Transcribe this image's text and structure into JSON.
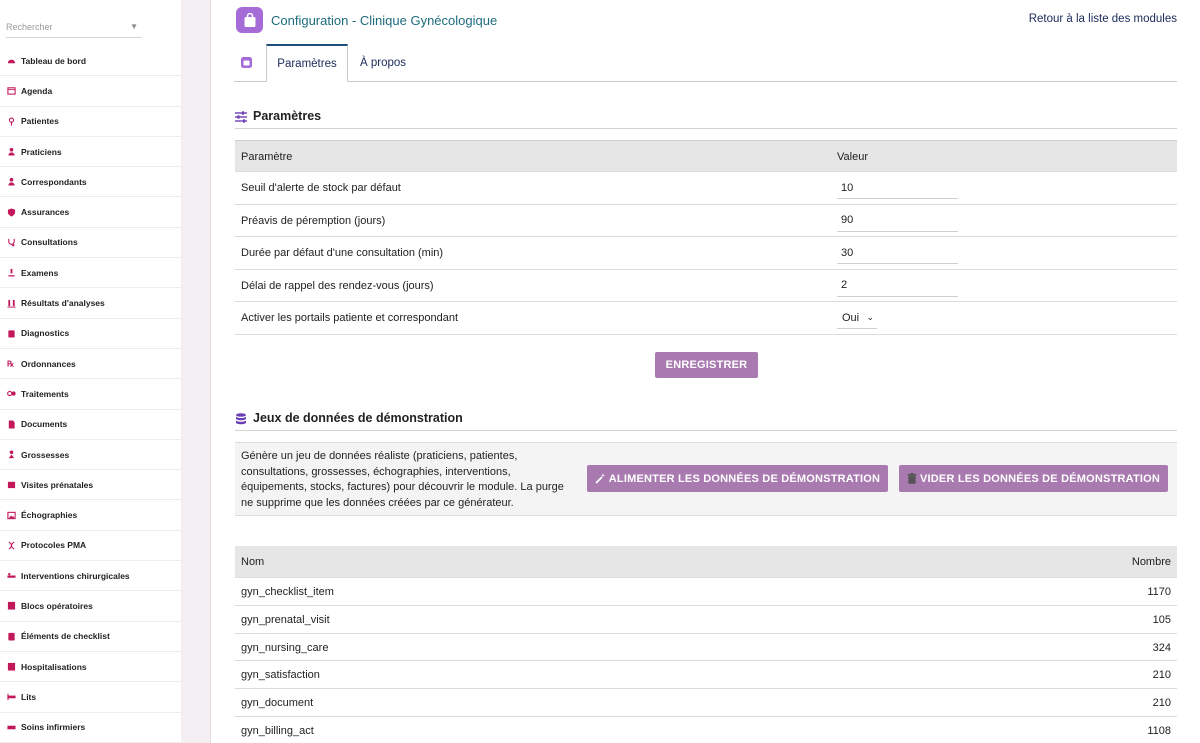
{
  "sidebar": {
    "search_placeholder": "Rechercher",
    "items": [
      {
        "label": "Tableau de bord",
        "icon": "dashboard-icon"
      },
      {
        "label": "Agenda",
        "icon": "calendar-icon"
      },
      {
        "label": "Patientes",
        "icon": "female-icon"
      },
      {
        "label": "Praticiens",
        "icon": "doctor-icon"
      },
      {
        "label": "Correspondants",
        "icon": "user-icon"
      },
      {
        "label": "Assurances",
        "icon": "shield-icon"
      },
      {
        "label": "Consultations",
        "icon": "stethoscope-icon"
      },
      {
        "label": "Examens",
        "icon": "microscope-icon"
      },
      {
        "label": "Résultats d'analyses",
        "icon": "vials-icon"
      },
      {
        "label": "Diagnostics",
        "icon": "clipboard-icon"
      },
      {
        "label": "Ordonnances",
        "icon": "prescription-icon"
      },
      {
        "label": "Traitements",
        "icon": "pills-icon"
      },
      {
        "label": "Documents",
        "icon": "file-icon"
      },
      {
        "label": "Grossesses",
        "icon": "baby-icon"
      },
      {
        "label": "Visites prénatales",
        "icon": "calendar-check-icon"
      },
      {
        "label": "Échographies",
        "icon": "image-icon"
      },
      {
        "label": "Protocoles PMA",
        "icon": "dna-icon"
      },
      {
        "label": "Interventions chirurgicales",
        "icon": "procedures-icon"
      },
      {
        "label": "Blocs opératoires",
        "icon": "hospital-icon"
      },
      {
        "label": "Éléments de checklist",
        "icon": "checklist-icon"
      },
      {
        "label": "Hospitalisations",
        "icon": "hospital-user-icon"
      },
      {
        "label": "Lits",
        "icon": "bed-icon"
      },
      {
        "label": "Soins infirmiers",
        "icon": "syringe-icon"
      }
    ]
  },
  "header": {
    "title": "Configuration - Clinique Gynécologique",
    "back_link": "Retour à la liste des modules"
  },
  "tabs": {
    "params": "Paramètres",
    "about": "À propos"
  },
  "settings": {
    "title": "Paramètres",
    "col_param": "Paramètre",
    "col_value": "Valeur",
    "rows": [
      {
        "label": "Seuil d'alerte de stock par défaut",
        "value": "10"
      },
      {
        "label": "Préavis de péremption (jours)",
        "value": "90"
      },
      {
        "label": "Durée par défaut d'une consultation (min)",
        "value": "30"
      },
      {
        "label": "Délai de rappel des rendez-vous (jours)",
        "value": "2"
      }
    ],
    "portal_label": "Activer les portails patiente et correspondant",
    "portal_value": "Oui",
    "save_label": "ENREGISTRER"
  },
  "demo": {
    "title": "Jeux de données de démonstration",
    "description": "Génère un jeu de données réaliste (praticiens, patientes, consultations, grossesses, échographies, interventions, équipements, stocks, factures) pour découvrir le module. La purge ne supprime que les données créées par ce générateur.",
    "fill_label": "ALIMENTER LES DONNÉES DE DÉMONSTRATION",
    "clear_label": "VIDER LES DONNÉES DE DÉMONSTRATION",
    "col_name": "Nom",
    "col_count": "Nombre",
    "rows": [
      {
        "name": "gyn_checklist_item",
        "count": "1170"
      },
      {
        "name": "gyn_prenatal_visit",
        "count": "105"
      },
      {
        "name": "gyn_nursing_care",
        "count": "324"
      },
      {
        "name": "gyn_satisfaction",
        "count": "210"
      },
      {
        "name": "gyn_document",
        "count": "210"
      },
      {
        "name": "gyn_billing_act",
        "count": "1108"
      }
    ]
  },
  "colors": {
    "accent": "#a56bd6",
    "button": "#a87ab0",
    "menu_icon": "#c2185b",
    "title": "#1e6b7e"
  }
}
